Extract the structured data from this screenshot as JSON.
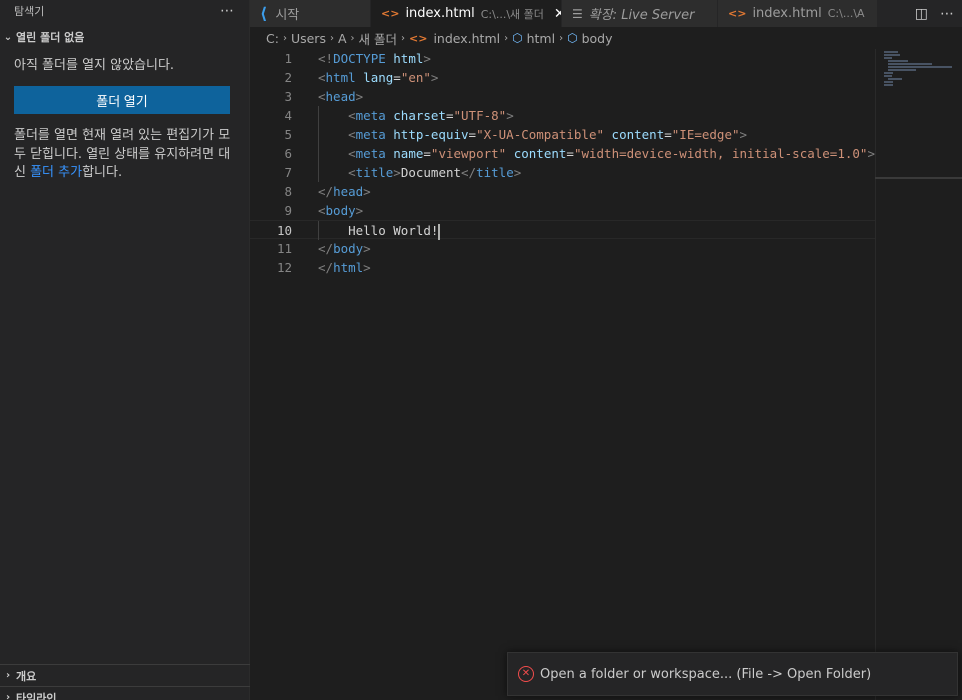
{
  "sidebar": {
    "title": "탐색기",
    "more_icon": "⋯",
    "section_title": "열린 폴더 없음",
    "no_folder_text": "아직 폴더를 열지 않았습니다.",
    "open_folder_button": "폴더 열기",
    "desc_part1": "폴더를 열면 현재 열려 있는 편집기가 모두 닫힙니다. 열린 상태를 유지하려면 대신 ",
    "desc_link": "폴더 추가",
    "desc_part2": "합니다.",
    "bottom_sections": [
      "개요",
      "타임라인"
    ]
  },
  "tabs": [
    {
      "icon": "vscode-icon",
      "label": "시작",
      "path": "",
      "active": false
    },
    {
      "icon": "html-icon",
      "label": "index.html",
      "path": "C:\\...\\새 폴더",
      "active": true
    },
    {
      "icon": "document-icon",
      "label": "확장: Live Server",
      "path": "",
      "active": false
    },
    {
      "icon": "html-icon",
      "label": "index.html",
      "path": "C:\\...\\A",
      "active": false
    }
  ],
  "breadcrumb": [
    "C:",
    "Users",
    "A",
    "새 폴더",
    "index.html",
    "html",
    "body"
  ],
  "editor": {
    "lines": [
      {
        "n": "1"
      },
      {
        "n": "2"
      },
      {
        "n": "3"
      },
      {
        "n": "4"
      },
      {
        "n": "5"
      },
      {
        "n": "6"
      },
      {
        "n": "7"
      },
      {
        "n": "8"
      },
      {
        "n": "9"
      },
      {
        "n": "10"
      },
      {
        "n": "11"
      },
      {
        "n": "12"
      }
    ],
    "current_line": "10",
    "hello_text": "Hello World!"
  },
  "notification": {
    "message": "Open a folder or workspace... (File -> Open Folder)"
  },
  "colors": {
    "accent_button": "#0e639c",
    "link": "#3794ff",
    "error": "#f14c4c",
    "tag": "#569cd6",
    "attr": "#9cdcfe",
    "string": "#ce9178"
  }
}
